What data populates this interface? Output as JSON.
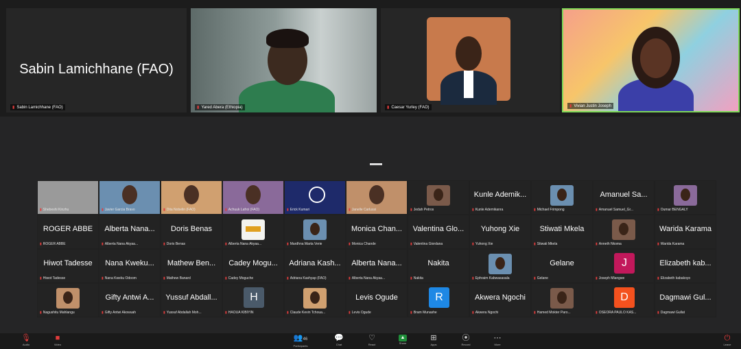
{
  "speakers": [
    {
      "big_name": "Sabin Lamichhane (FAO)",
      "tag": "Sabin Lamichhane (FAO)"
    },
    {
      "big_name": "",
      "tag": "Yared Abera (Ethiopia)"
    },
    {
      "big_name": "",
      "tag": "Caesar Yurley (FAO)"
    },
    {
      "big_name": "",
      "tag": "Vivian Justin Joseph"
    }
  ],
  "gallery": [
    {
      "name": "",
      "label": "Shebeshi Kinzhu",
      "style": "gray-photo"
    },
    {
      "name": "",
      "label": "Javier Garcia Bravo",
      "style": "photo"
    },
    {
      "name": "",
      "label": "Dita Nobelin (FAO)",
      "style": "photo"
    },
    {
      "name": "",
      "label": "Achuuk Lafroi (FAO)",
      "style": "photo"
    },
    {
      "name": "",
      "label": "Erick Kumari",
      "style": "logo-blue"
    },
    {
      "name": "",
      "label": "Janelle Carlussi",
      "style": "photo"
    },
    {
      "name": "",
      "label": "Jedah Petros",
      "style": "photo-small"
    },
    {
      "name": "Kunle Ademik...",
      "label": "Kunle Ademikanra",
      "style": "name"
    },
    {
      "name": "",
      "label": "Michael Frimpong",
      "style": "photo-small"
    },
    {
      "name": "Amanuel Sa...",
      "label": "Amanuel Samuel_Gr...",
      "style": "name"
    },
    {
      "name": "",
      "label": "Oumar BENGALY",
      "style": "photo-small"
    },
    {
      "name": "ROGER ABBE",
      "label": "ROGER ABBE",
      "style": "name"
    },
    {
      "name": "Alberta Nana...",
      "label": "Alberta Nana Akyaa...",
      "style": "name"
    },
    {
      "name": "Doris Benas",
      "label": "Doris Benas",
      "style": "name"
    },
    {
      "name": "",
      "label": "Alberta Nana Akyaa...",
      "style": "logo-white"
    },
    {
      "name": "",
      "label": "Mardhna Marta Verie",
      "style": "photo-small"
    },
    {
      "name": "Monica Chan...",
      "label": "Monica Chande",
      "style": "name"
    },
    {
      "name": "Valentina Glo...",
      "label": "Valentina Giordana",
      "style": "name"
    },
    {
      "name": "Yuhong Xie",
      "label": "Yuhong Xie",
      "style": "name"
    },
    {
      "name": "Stiwati Mkela",
      "label": "Stiwati Mkela",
      "style": "name"
    },
    {
      "name": "",
      "label": "Anneth Nkoma",
      "style": "photo-small"
    },
    {
      "name": "Warida Karama",
      "label": "Warida Karama",
      "style": "name"
    },
    {
      "name": "Hiwot Tadesse",
      "label": "Hiwot Tadesse",
      "style": "name"
    },
    {
      "name": "Nana Kweku...",
      "label": "Nana Kweku Odoom",
      "style": "name"
    },
    {
      "name": "Mathew Ben...",
      "label": "Mathew Banard",
      "style": "name"
    },
    {
      "name": "Cadey Mogu...",
      "label": "Cadey Moguche",
      "style": "name"
    },
    {
      "name": "Adriana Kash...",
      "label": "Adriana Kashyap (FAO)",
      "style": "name"
    },
    {
      "name": "Alberta Nana...",
      "label": "Alberta Nana Akyaa...",
      "style": "name"
    },
    {
      "name": "Nakita",
      "label": "Nakita",
      "style": "name"
    },
    {
      "name": "",
      "label": "Ephraim Kabwasasala",
      "style": "photo-small"
    },
    {
      "name": "Gelane",
      "label": "Gelane",
      "style": "name"
    },
    {
      "name": "",
      "label": "Joseph Mlangwe",
      "style": "letter",
      "letter": "J",
      "color": "#c2185b"
    },
    {
      "name": "Elizabeth kab...",
      "label": "Elizabeth kabakoyo",
      "style": "name"
    },
    {
      "name": "",
      "label": "Nagushitu Mahlangu",
      "style": "photo-small"
    },
    {
      "name": "Gifty Antwi A...",
      "label": "Gifty Antwi Akowuah",
      "style": "name"
    },
    {
      "name": "Yussuf Abdall...",
      "label": "Yussuf Abdallah Moh...",
      "style": "name"
    },
    {
      "name": "",
      "label": "HAOUA KIBIYIN",
      "style": "letter",
      "letter": "H",
      "color": "#4a5a6a"
    },
    {
      "name": "",
      "label": "Claude Kevin Tchoua...",
      "style": "photo-small"
    },
    {
      "name": "Levis Ogude",
      "label": "Levis Ogude",
      "style": "name"
    },
    {
      "name": "",
      "label": "Bram Munashe",
      "style": "letter",
      "letter": "R",
      "color": "#1e88e5"
    },
    {
      "name": "Akwera Ngochi",
      "label": "Akwera Ngochi",
      "style": "name"
    },
    {
      "name": "",
      "label": "Hamed Mokter Paro...",
      "style": "photo-small"
    },
    {
      "name": "",
      "label": "OSEORA PAULO KAS...",
      "style": "letter",
      "letter": "D",
      "color": "#f4511e"
    },
    {
      "name": "Dagmawi Gul...",
      "label": "Dagmawi Gullat",
      "style": "name"
    }
  ],
  "toolbar": {
    "audio": "Audio",
    "video": "Video",
    "participants": "Participants",
    "participants_count": "46",
    "chat": "Chat",
    "react": "React",
    "share": "Share",
    "apps": "Apps",
    "record": "Record",
    "more": "More",
    "leave": "Leave"
  },
  "colors": {
    "background": "#252526",
    "tile": "#232323",
    "muted_mic": "#e23c3c",
    "share_green": "#1f8f3a"
  }
}
